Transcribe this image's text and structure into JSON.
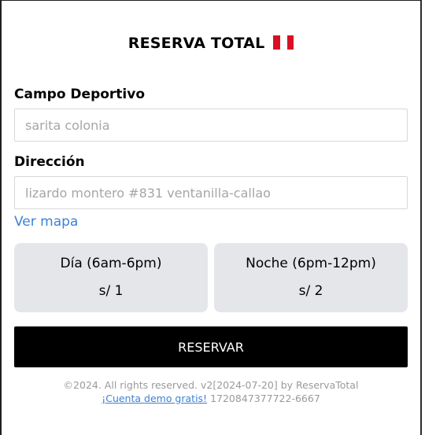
{
  "header": {
    "title": "RESERVA TOTAL",
    "flag_icon": "peru-flag-icon"
  },
  "form": {
    "campo_label": "Campo Deportivo",
    "campo_placeholder": "sarita colonia",
    "direccion_label": "Dirección",
    "direccion_placeholder": "lizardo montero #831 ventanilla-callao",
    "map_link": "Ver mapa"
  },
  "shifts": [
    {
      "name": "Día (6am-6pm)",
      "price": "s/ 1"
    },
    {
      "name": "Noche (6pm-12pm)",
      "price": "s/ 2"
    }
  ],
  "actions": {
    "reserve_label": "RESERVAR"
  },
  "footer": {
    "copyright": "©2024. All rights reserved. v2[2024-07-20] by ReservaTotal",
    "demo_link": "¡Cuenta demo gratis!",
    "phone": "1720847377722-6667"
  },
  "colors": {
    "accent_link": "#3b82d6",
    "button_bg": "#000000",
    "card_bg": "#e5e6e9"
  }
}
